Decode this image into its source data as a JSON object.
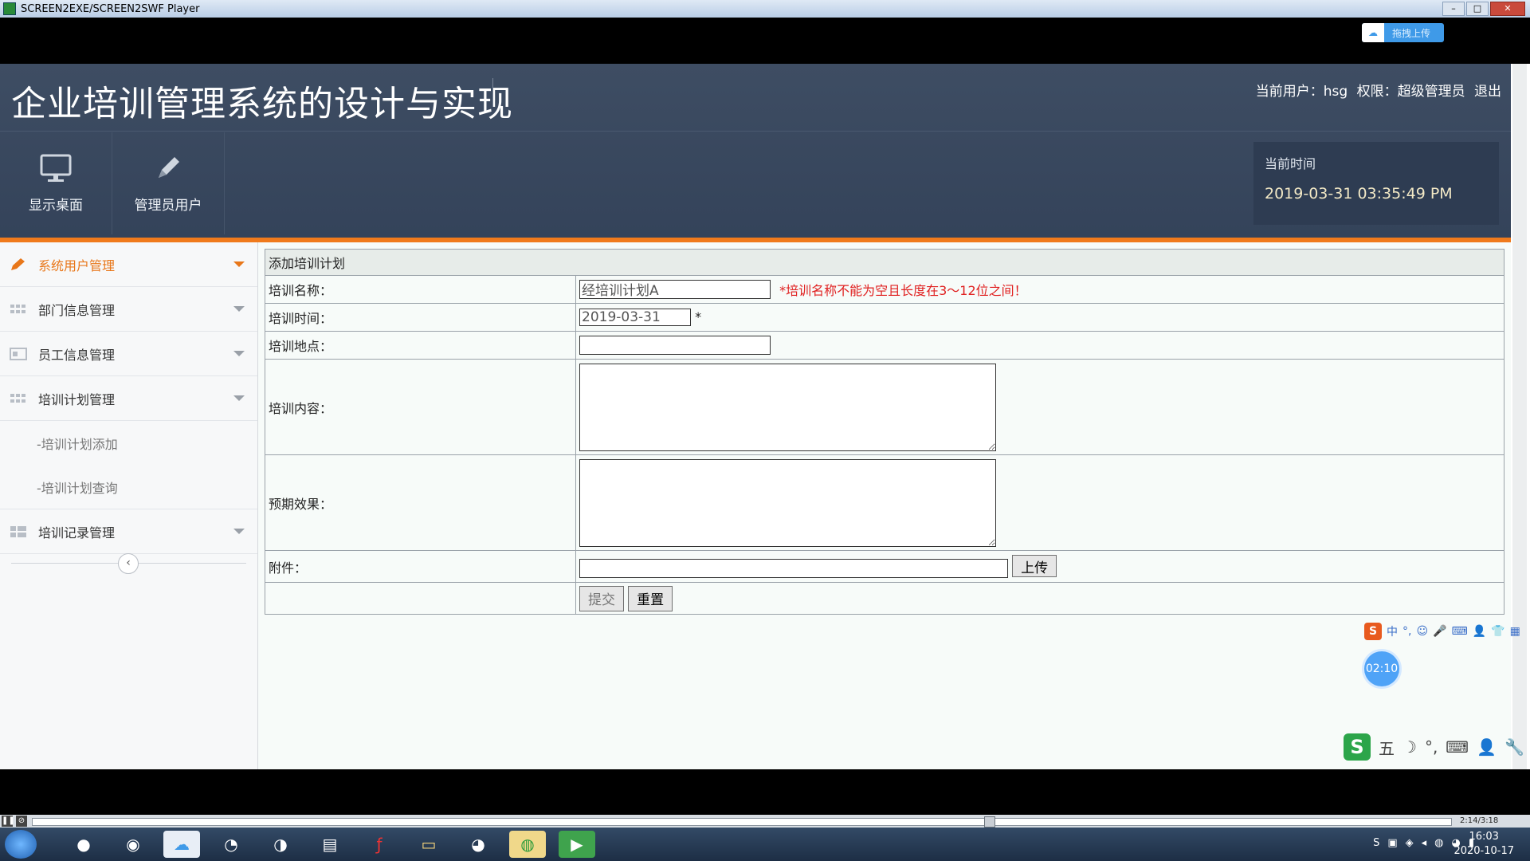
{
  "player": {
    "title": "SCREEN2EXE/SCREEN2SWF Player",
    "cloud_upload_label": "拖拽上传",
    "elapsed": "2:14/3:18"
  },
  "app": {
    "title": "企业培训管理系统的设计与实现",
    "user_info": {
      "current_user_label": "当前用户：hsg",
      "permission_label": "权限：超级管理员",
      "logout_label": "退出"
    },
    "nav_tiles": [
      {
        "label": "显示桌面",
        "icon": "monitor-icon"
      },
      {
        "label": "管理员用户",
        "icon": "pencil-icon"
      }
    ],
    "time_box": {
      "label": "当前时间",
      "value": "2019-03-31 03:35:49 PM"
    }
  },
  "sidebar": {
    "items": [
      {
        "label": "系统用户管理",
        "icon": "pencil-icon",
        "active": true
      },
      {
        "label": "部门信息管理",
        "icon": "grid-icon"
      },
      {
        "label": "员工信息管理",
        "icon": "card-icon"
      },
      {
        "label": "培训计划管理",
        "icon": "grid-icon"
      }
    ],
    "sub_items": [
      {
        "label": "-培训计划添加"
      },
      {
        "label": "-培训计划查询"
      }
    ],
    "last_item": {
      "label": "培训记录管理",
      "icon": "list-icon"
    }
  },
  "form": {
    "header": "添加培训计划",
    "name_label": "培训名称：",
    "name_value": "经培训计划A",
    "name_error": "*培训名称不能为空且长度在3～12位之间！",
    "time_label": "培训时间：",
    "time_value": "2019-03-31",
    "time_required": "*",
    "place_label": "培训地点：",
    "place_value": "",
    "content_label": "培训内容：",
    "effect_label": "预期效果：",
    "attachment_label": "附件：",
    "upload_button": "上传",
    "submit_button": "提交",
    "reset_button": "重置"
  },
  "overlays": {
    "ime_top": [
      "中",
      "°,",
      "☺",
      "🎤",
      "⌨",
      "👤",
      "👕",
      "▦"
    ],
    "timer": "02:10",
    "ime_bottom": [
      "五",
      "☽",
      "°,",
      "⌨",
      "👤",
      "🔧"
    ]
  },
  "taskbar": {
    "clock_time": "16:03",
    "clock_date": "2020-10-17"
  }
}
